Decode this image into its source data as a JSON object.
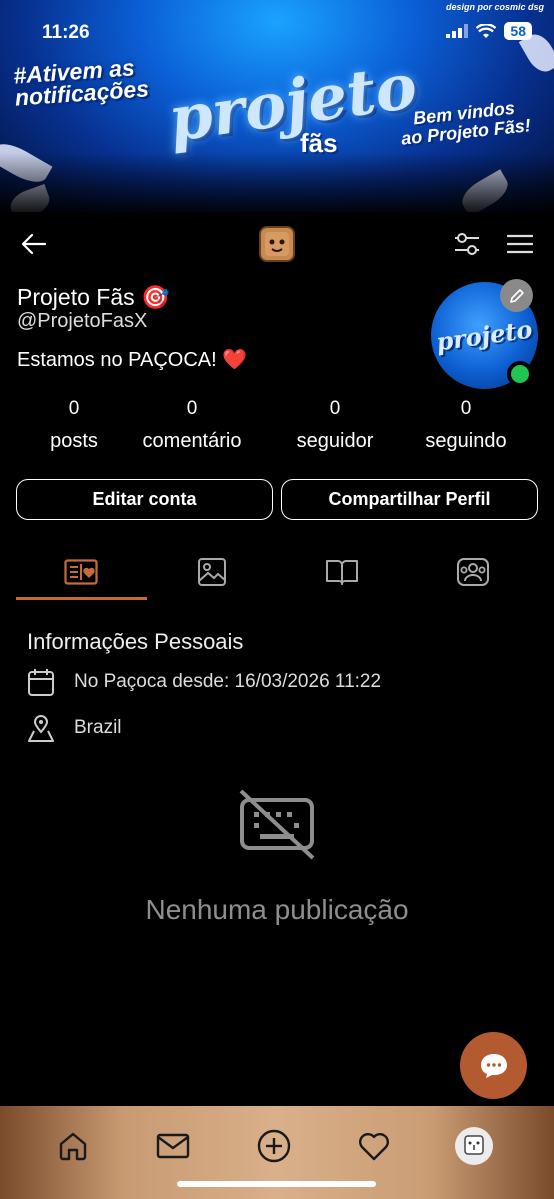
{
  "status_bar": {
    "time": "11:26",
    "battery": "58"
  },
  "banner": {
    "credit": "design por cosmic dsg",
    "left_text_1": "#Ativem as",
    "left_text_2": "notificações",
    "logo_main": "projeto",
    "logo_sub": "fãs",
    "right_text_1": "Bem vindos",
    "right_text_2": "ao Projeto Fãs!"
  },
  "profile": {
    "name": "Projeto Fãs 🎯",
    "handle": "@ProjetoFasX",
    "bio": "Estamos no PAÇOCA! ❤️",
    "avatar_text": "projeto"
  },
  "stats": [
    {
      "value": "0",
      "label": "posts"
    },
    {
      "value": "0",
      "label": "comentário"
    },
    {
      "value": "0",
      "label": "seguidor"
    },
    {
      "value": "0",
      "label": "seguindo"
    }
  ],
  "actions": {
    "edit": "Editar conta",
    "share": "Compartilhar Perfil"
  },
  "info": {
    "title": "Informações Pessoais",
    "joined": "No Paçoca desde: 16/03/2026 11:22",
    "location": "Brazil"
  },
  "empty_state": "Nenhuma publicação",
  "colors": {
    "accent": "#c86b3a",
    "fab": "#b45a30",
    "online": "#23c552"
  }
}
